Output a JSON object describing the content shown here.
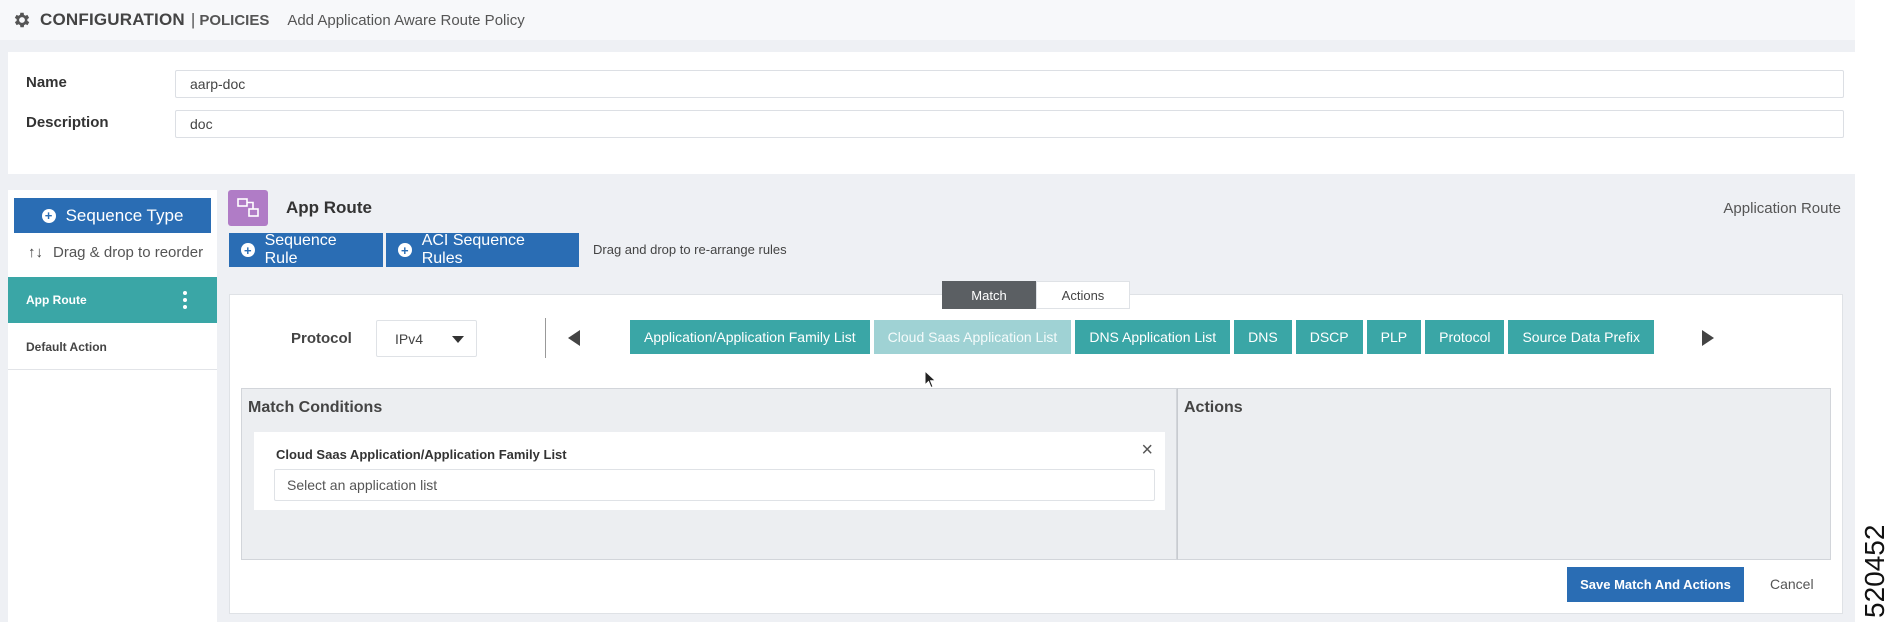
{
  "header": {
    "title": "CONFIGURATION",
    "separator": "|",
    "section": "POLICIES",
    "subtitle": "Add Application Aware Route Policy"
  },
  "form": {
    "name_label": "Name",
    "name_value": "aarp-doc",
    "description_label": "Description",
    "description_value": "doc"
  },
  "sidebar": {
    "sequence_type_label": "Sequence Type",
    "drag_hint": "Drag & drop to reorder",
    "items": [
      {
        "label": "App Route",
        "active": true
      },
      {
        "label": "Default Action",
        "active": false
      }
    ]
  },
  "route": {
    "title": "App Route",
    "type": "Application Route",
    "sequence_rule_label": "Sequence Rule",
    "aci_sequence_rules_label": "ACI Sequence Rules",
    "rules_hint": "Drag and drop to re-arrange rules"
  },
  "tabs": {
    "match": "Match",
    "actions": "Actions"
  },
  "protocol": {
    "label": "Protocol",
    "selected": "IPv4"
  },
  "match_chips": [
    {
      "label": "Application/Application Family List",
      "selected": false
    },
    {
      "label": "Cloud Saas Application List",
      "selected": true
    },
    {
      "label": "DNS Application List",
      "selected": false
    },
    {
      "label": "DNS",
      "selected": false
    },
    {
      "label": "DSCP",
      "selected": false
    },
    {
      "label": "PLP",
      "selected": false
    },
    {
      "label": "Protocol",
      "selected": false
    },
    {
      "label": "Source Data Prefix",
      "selected": false
    }
  ],
  "match_conditions": {
    "title": "Match Conditions",
    "condition_title": "Cloud Saas Application/Application Family List",
    "select_placeholder": "Select an application list"
  },
  "actions_panel": {
    "title": "Actions"
  },
  "footer": {
    "save_label": "Save Match And Actions",
    "cancel_label": "Cancel"
  },
  "figure_number": "520452",
  "colors": {
    "primary_blue": "#2a6db4",
    "teal": "#3aa6a6",
    "teal_selected": "#9fd2d4",
    "route_icon_purple": "#b07cc6"
  }
}
